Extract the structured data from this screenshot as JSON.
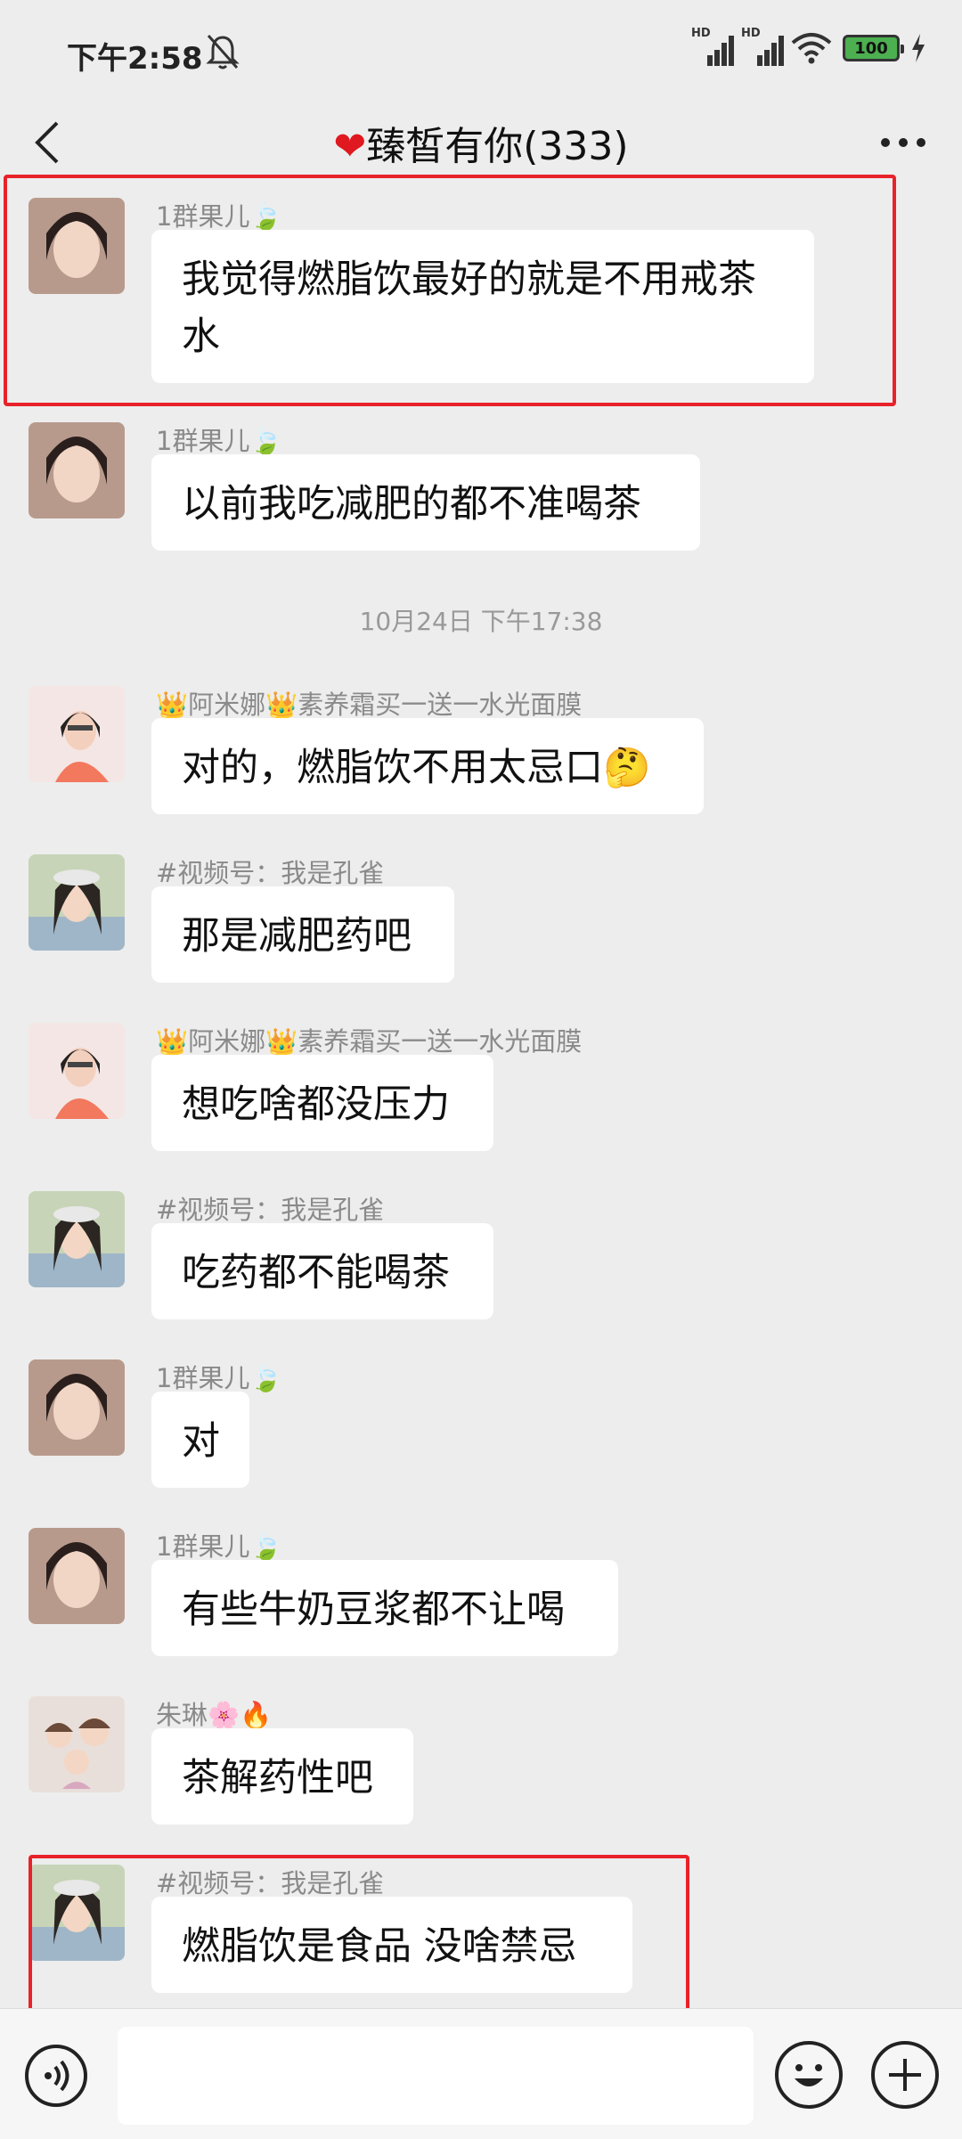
{
  "status_bar": {
    "time": "下午2:58",
    "signal_1": "HD",
    "signal_2": "HD",
    "battery": "100"
  },
  "header": {
    "heart": "❤",
    "title": "臻皙有你(333)"
  },
  "timestamps": {
    "t1": "10月24日 下午17:38"
  },
  "messages": [
    {
      "sender": "1群果儿🍃",
      "text": "我觉得燃脂饮最好的就是不用戒茶水"
    },
    {
      "sender": "1群果儿🍃",
      "text": "以前我吃减肥的都不准喝茶"
    },
    {
      "sender": "👑阿米娜👑素养霜买一送一水光面膜",
      "text": "对的，燃脂饮不用太忌口🤔"
    },
    {
      "sender": "#视频号：我是孔雀",
      "text": "那是减肥药吧"
    },
    {
      "sender": "👑阿米娜👑素养霜买一送一水光面膜",
      "text": "想吃啥都没压力"
    },
    {
      "sender": "#视频号：我是孔雀",
      "text": "吃药都不能喝茶"
    },
    {
      "sender": "1群果儿🍃",
      "text": "对"
    },
    {
      "sender": "1群果儿🍃",
      "text": "有些牛奶豆浆都不让喝"
    },
    {
      "sender": "朱琳🌸🔥",
      "text": "茶解药性吧"
    },
    {
      "sender": "#视频号：我是孔雀",
      "text": "燃脂饮是食品 没啥禁忌"
    }
  ],
  "colors": {
    "background": "#ededed",
    "bubble": "#ffffff",
    "highlight": "#e8222a",
    "title_heart": "#e0181f"
  }
}
